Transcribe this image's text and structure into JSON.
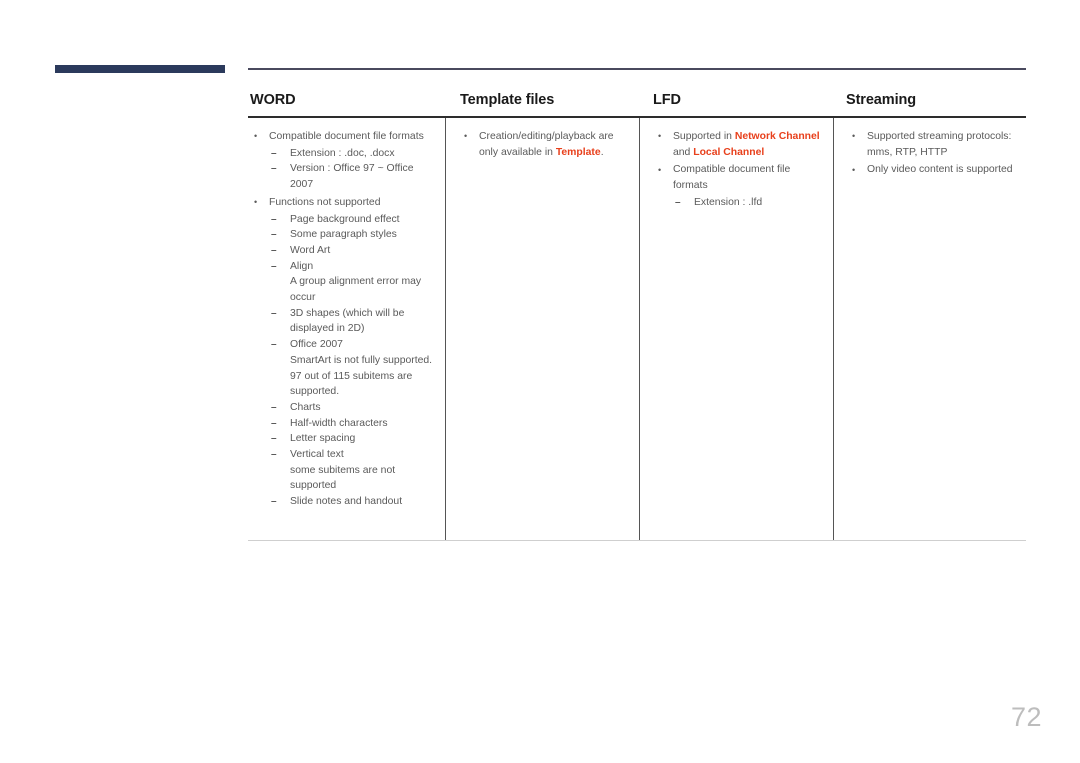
{
  "page": {
    "number": "72",
    "accent_navy": "#2b3a5c",
    "highlight_color": "#e8401c",
    "body_text_color": "#5a5a5a"
  },
  "table": {
    "columns": [
      {
        "header": "WORD"
      },
      {
        "header": "Template files"
      },
      {
        "header": "LFD"
      },
      {
        "header": "Streaming"
      }
    ],
    "word_column": {
      "item1": "Compatible document file formats",
      "item1_sub1": "Extension : .doc, .docx",
      "item1_sub2": "Version : Office 97 ~ Office 2007",
      "item2": "Functions not supported",
      "item2_sub1": "Page background effect",
      "item2_sub2": "Some paragraph styles",
      "item2_sub3": "Word Art",
      "item2_sub4": "Align",
      "item2_sub4_note": "A group alignment error may occur",
      "item2_sub5": "3D shapes (which will be displayed in 2D)",
      "item2_sub6": "Office 2007",
      "item2_sub6_note": "SmartArt is not fully supported. 97 out of 115 subitems are supported.",
      "item2_sub7": "Charts",
      "item2_sub8": "Half-width characters",
      "item2_sub9": "Letter spacing",
      "item2_sub10": "Vertical text",
      "item2_sub10_note": "some subitems are not supported",
      "item2_sub11": "Slide notes and handout"
    },
    "template_column": {
      "item1_pre": "Creation/editing/playback are only available in ",
      "item1_highlight": "Template",
      "item1_post": "."
    },
    "lfd_column": {
      "item1_pre": "Supported in ",
      "item1_highlight1": "Network Channel",
      "item1_mid": " and ",
      "item1_highlight2": "Local Channel",
      "item2": "Compatible document file formats",
      "item2_sub1": "Extension : .lfd"
    },
    "streaming_column": {
      "item1": "Supported streaming protocols: mms, RTP, HTTP",
      "item2": "Only video content is supported"
    }
  }
}
